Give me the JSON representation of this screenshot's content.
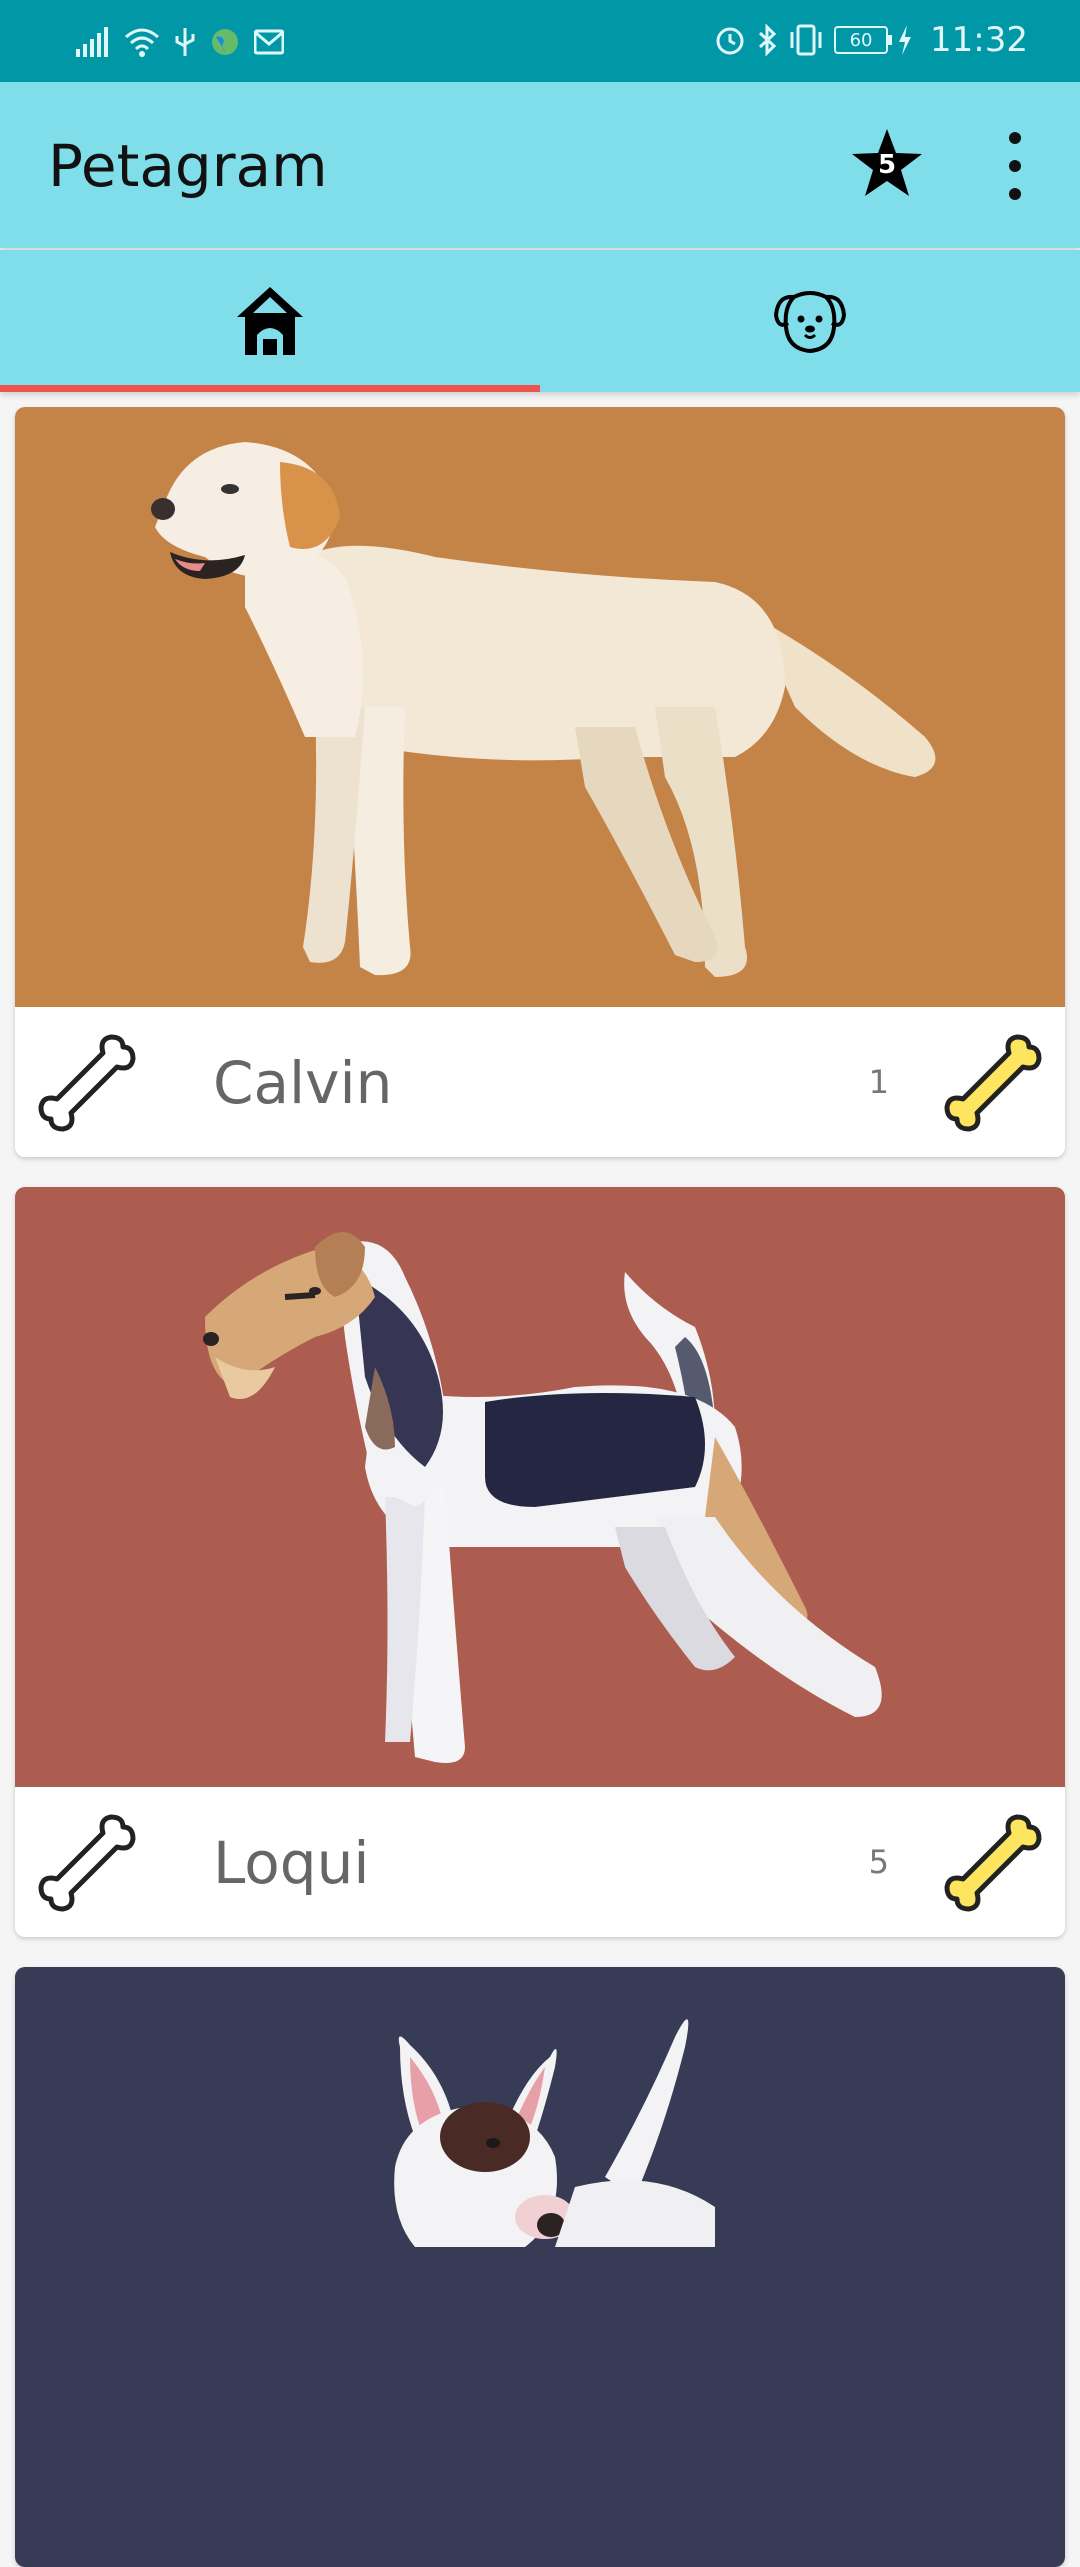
{
  "status_bar": {
    "time": "11:32",
    "battery": "60"
  },
  "app_bar": {
    "title": "Petagram",
    "favorites_count": "5"
  },
  "tabs": [
    {
      "label": "home-icon",
      "selected": true
    },
    {
      "label": "dog-face-icon",
      "selected": false
    }
  ],
  "colors": {
    "status_bar": "#0097A7",
    "app_bar": "#80DEEA",
    "tab_indicator": "#EF5350",
    "bone_yellow": "#FDE560"
  },
  "pets": [
    {
      "name": "Calvin",
      "likes": "1",
      "background": "#C58447"
    },
    {
      "name": "Loqui",
      "likes": "5",
      "background": "#AD5D50"
    },
    {
      "name": "",
      "likes": "",
      "background": "#383B56"
    }
  ]
}
